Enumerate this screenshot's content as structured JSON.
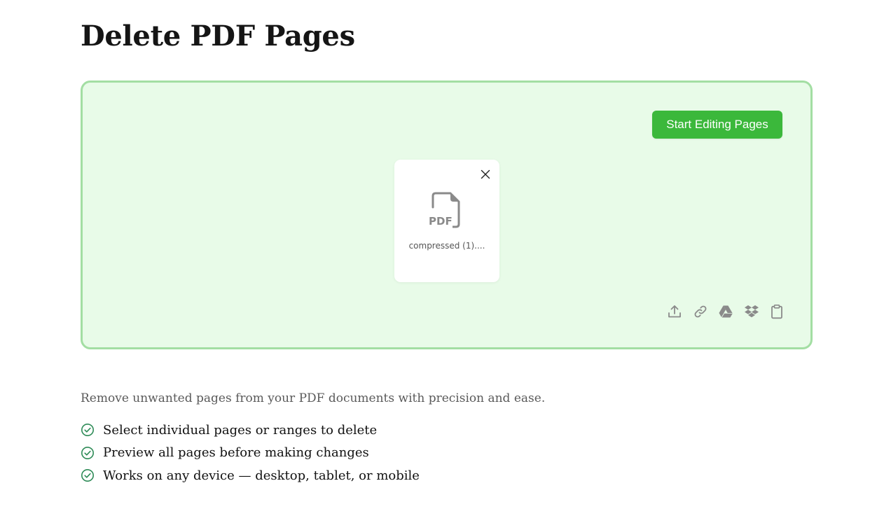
{
  "page": {
    "title": "Delete PDF Pages"
  },
  "uploader": {
    "start_button_label": "Start Editing Pages",
    "file": {
      "name": "compressed (1)....",
      "icon_label": "PDF"
    },
    "sources": [
      {
        "icon": "upload-icon"
      },
      {
        "icon": "link-icon"
      },
      {
        "icon": "google-drive-icon"
      },
      {
        "icon": "dropbox-icon"
      },
      {
        "icon": "clipboard-icon"
      }
    ]
  },
  "description": "Remove unwanted pages from your PDF documents with precision and ease.",
  "features": [
    {
      "text": "Select individual pages or ranges to delete",
      "icon": "check-circle-icon"
    },
    {
      "text": "Preview all pages before making changes",
      "icon": "check-circle-icon"
    },
    {
      "text": "Works on any device — desktop, tablet, or mobile",
      "icon": "check-circle-icon"
    }
  ],
  "colors": {
    "accent_green": "#3bb83b",
    "dropzone_bg": "#e8fbe8",
    "dropzone_border": "#a3dea3",
    "icon_gray": "#8a8a8a",
    "check_green": "#2e8b57"
  }
}
